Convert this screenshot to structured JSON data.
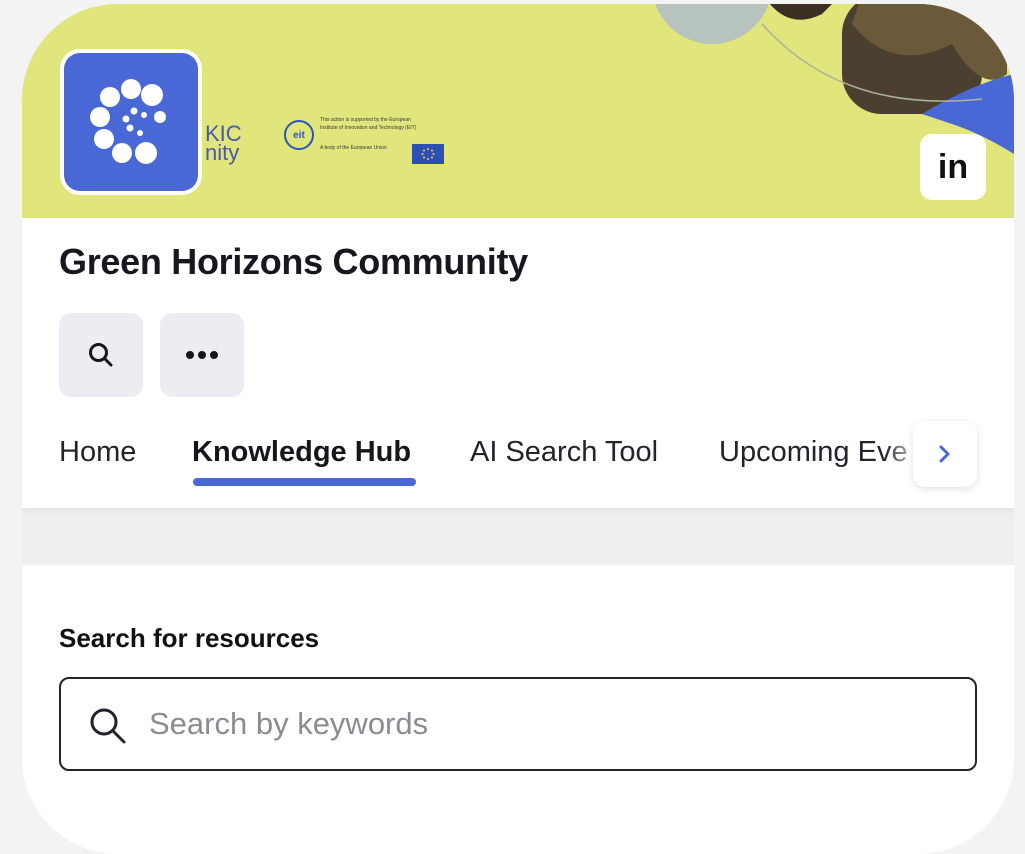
{
  "community": {
    "name": "Green Horizons Community",
    "banner": {
      "brand_text_line1": "KIC",
      "brand_text_line2": "nity",
      "eit_mark": "eit",
      "eit_text_line1": "This action is supported by the European",
      "eit_text_line2": "Institute of Innovation and Technology (EIT)",
      "eit_text_line3": "A body of the European Union",
      "background_color": "#e0e57c"
    },
    "logo": {
      "icon": "community-logo-icon",
      "color": "#4a67d6"
    },
    "linkedin": {
      "label": "in",
      "icon": "linkedin-icon"
    }
  },
  "actions": {
    "search": {
      "icon": "search-icon"
    },
    "more": {
      "icon": "more-horizontal-icon"
    }
  },
  "tabs": {
    "items": [
      {
        "label": "Home",
        "active": false
      },
      {
        "label": "Knowledge Hub",
        "active": true
      },
      {
        "label": "AI Search Tool",
        "active": false
      },
      {
        "label": "Upcoming Eve",
        "active": false
      }
    ],
    "accent_color": "#4a67d6",
    "next_icon": "chevron-right-icon"
  },
  "search_section": {
    "heading": "Search for resources",
    "input": {
      "placeholder": "Search by keywords",
      "value": ""
    },
    "icon": "search-icon"
  }
}
